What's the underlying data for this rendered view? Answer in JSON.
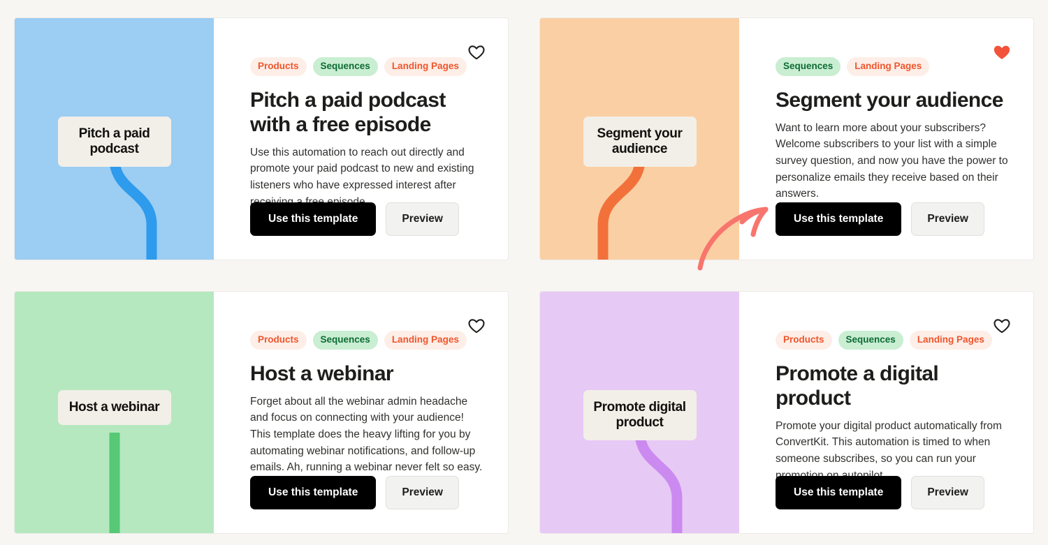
{
  "page": {
    "background_color": "#f7f6f3",
    "layout": "2x2 template card grid"
  },
  "labels": {
    "favorite_icon": "heart-icon",
    "favorite_active_icon": "heart-filled-icon"
  },
  "annotation": {
    "type": "arrow",
    "color": "#f87171",
    "points_to": "Use this template button on Segment your audience card"
  },
  "tag_styles": {
    "Products": "orange",
    "Sequences": "green",
    "Landing Pages": "orange"
  },
  "cards": [
    {
      "id": "pitch-a-paid-podcast",
      "tags": [
        "Products",
        "Sequences",
        "Landing Pages"
      ],
      "title": "Pitch a paid podcast with a free episode",
      "description": "Use this automation to reach out directly and promote your paid podcast to new and existing listeners who have expressed interest after receiving a free episode.",
      "thumb_label": "Pitch a paid podcast",
      "thumb_bg": "#9ccdf2",
      "thumb_line": "#2e9bed",
      "thumb_flow": "s-curve-right",
      "primary_button": "Use this template",
      "secondary_button": "Preview",
      "favorited": false
    },
    {
      "id": "segment-your-audience",
      "tags": [
        "Sequences",
        "Landing Pages"
      ],
      "title": "Segment your audience",
      "description": "Want to learn more about your subscribers? Welcome subscribers to your list with a simple survey question, and now you have the power to personalize emails they receive based on their answers.",
      "thumb_label": "Segment your audience",
      "thumb_bg": "#fbcfa4",
      "thumb_line": "#f2713b",
      "thumb_flow": "s-curve-left",
      "primary_button": "Use this template",
      "secondary_button": "Preview",
      "favorited": true
    },
    {
      "id": "host-a-webinar",
      "tags": [
        "Products",
        "Sequences",
        "Landing Pages"
      ],
      "title": "Host a webinar",
      "description": "Forget about all the webinar admin headache and focus on connecting with your audience! This template does the heavy lifting for you by automating webinar notifications, and follow-up emails. Ah, running a webinar never felt so easy.",
      "thumb_label": "Host a webinar",
      "thumb_bg": "#b6e8bf",
      "thumb_line": "#56c876",
      "thumb_flow": "straight",
      "primary_button": "Use this template",
      "secondary_button": "Preview",
      "favorited": false
    },
    {
      "id": "promote-a-digital-product",
      "tags": [
        "Products",
        "Sequences",
        "Landing Pages"
      ],
      "title": "Promote a digital product",
      "description": "Promote your digital product automatically from ConvertKit. This automation is timed to when someone subscribes, so you can run your promotion on autopilot.",
      "thumb_label": "Promote digital product",
      "thumb_bg": "#e7c9f5",
      "thumb_line": "#cb8af0",
      "thumb_flow": "s-curve-right",
      "primary_button": "Use this template",
      "secondary_button": "Preview",
      "favorited": false
    }
  ]
}
